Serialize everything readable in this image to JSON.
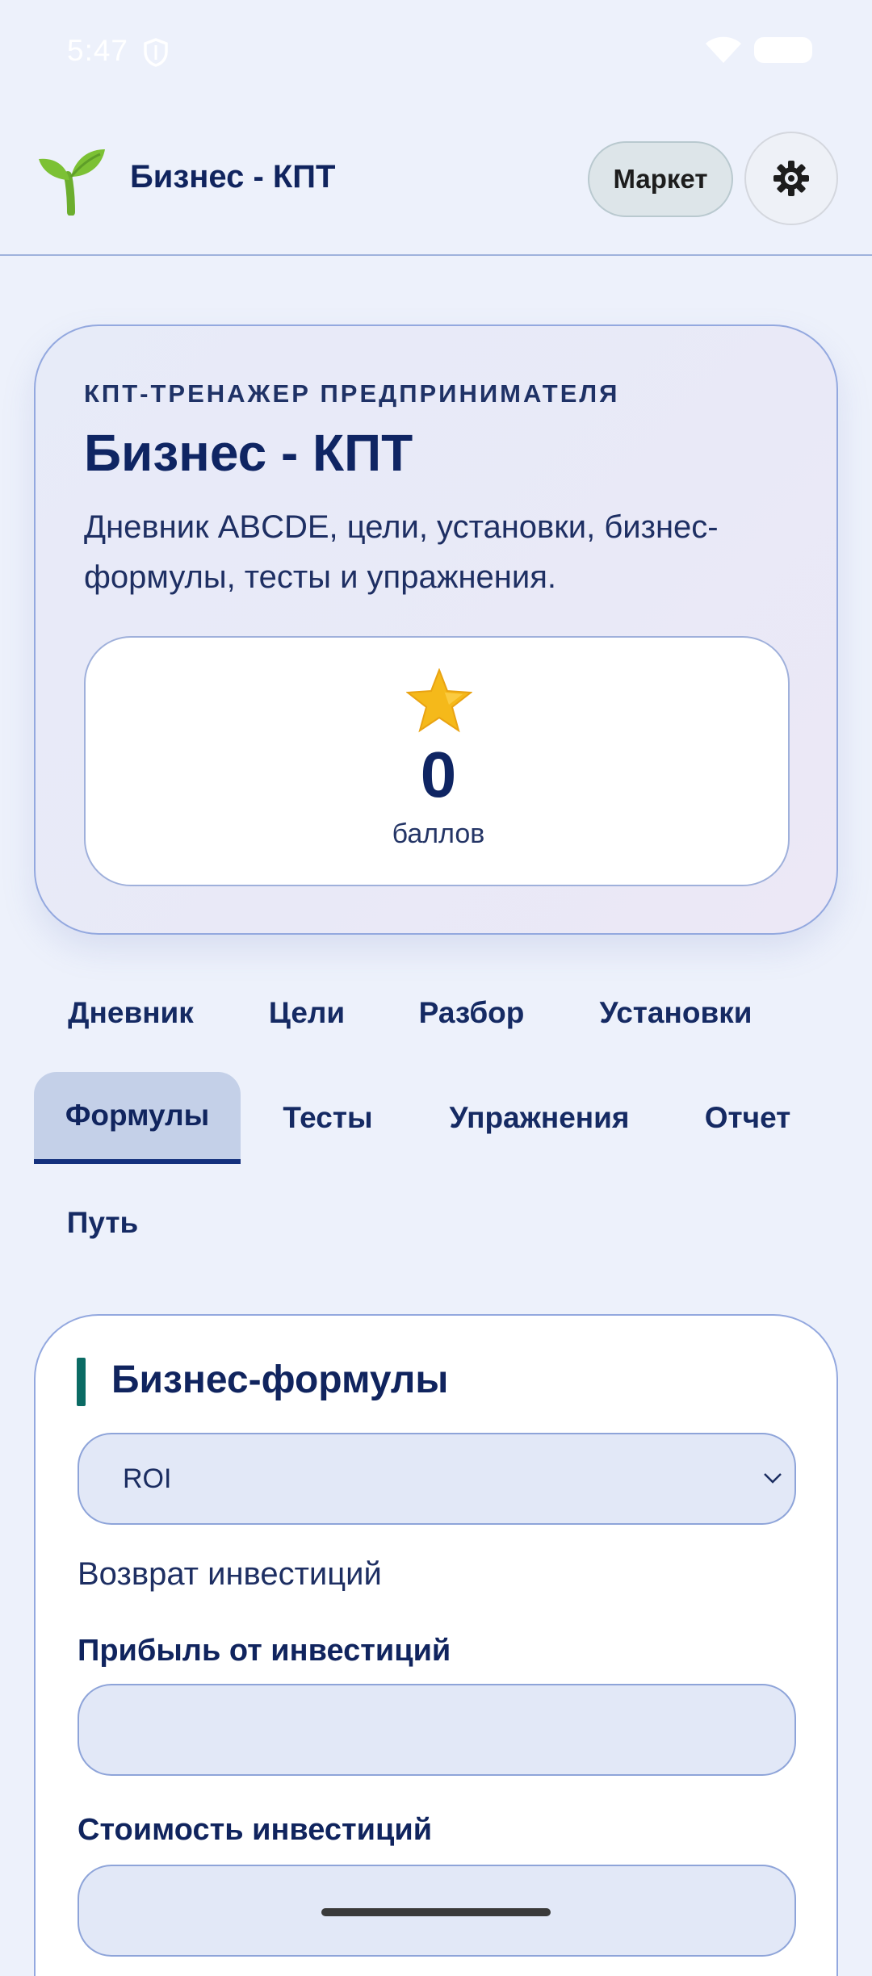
{
  "status_bar": {
    "time": "5:47"
  },
  "header": {
    "app_title": "Бизнес - КПТ",
    "market_label": "Маркет",
    "logo_icon": "sprout-icon",
    "settings_icon": "gear-icon"
  },
  "hero": {
    "eyebrow": "КПТ-ТРЕНАЖЕР ПРЕДПРИНИМАТЕЛЯ",
    "title": "Бизнес - КПТ",
    "description": "Дневник ABCDE, цели, установки, бизнес-формулы, тесты и упражнения.",
    "score": {
      "icon": "star-icon",
      "value": "0",
      "label": "баллов"
    }
  },
  "tabs": [
    {
      "label": "Дневник"
    },
    {
      "label": "Цели"
    },
    {
      "label": "Разбор"
    },
    {
      "label": "Установки"
    },
    {
      "label": "Формулы",
      "active": true
    },
    {
      "label": "Тесты"
    },
    {
      "label": "Упражнения"
    },
    {
      "label": "Отчет"
    },
    {
      "label": "Путь"
    }
  ],
  "formulas": {
    "section_title": "Бизнес-формулы",
    "selected_formula": "ROI",
    "formula_description": "Возврат инвестиций",
    "fields": [
      {
        "label": "Прибыль от инвестиций",
        "value": ""
      },
      {
        "label": "Стоимость инвестиций",
        "value": ""
      }
    ]
  },
  "colors": {
    "background": "#edf1fb",
    "primary_text": "#10245e",
    "accent_bar": "#0b6b64",
    "active_tab_underline": "#14307d",
    "star": "#f5b91a"
  }
}
